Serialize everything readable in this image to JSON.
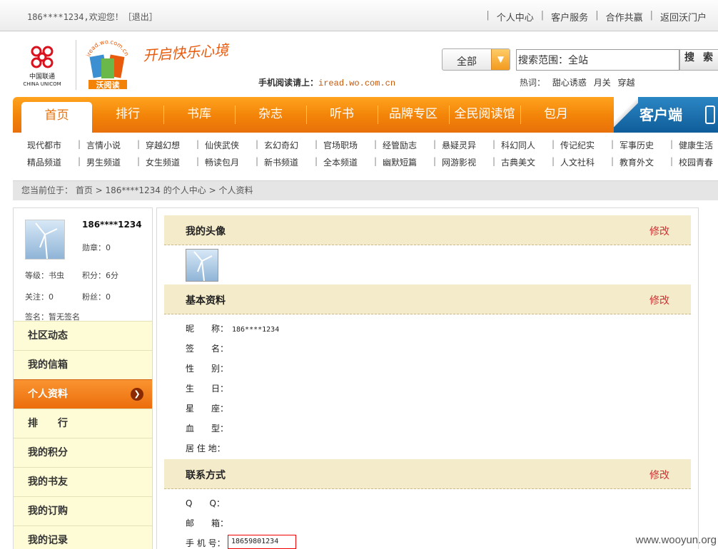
{
  "topbar": {
    "welcome": "186****1234,欢迎您！［退出］",
    "links": [
      "个人中心",
      "客户服务",
      "合作共赢",
      "返回沃门户"
    ]
  },
  "header": {
    "brand_name": "中国联通",
    "brand_name_en": "CHINA UNICOM",
    "logo_text": "沃阅读",
    "logo_arc": "iread.wo.com.cn",
    "slogan": "开启快乐心境",
    "mobile_tip_label": "手机阅读请上：",
    "mobile_tip_url": "iread.wo.com.cn"
  },
  "search": {
    "category": "全部",
    "input_value": "搜索范围：全站",
    "button": "搜索",
    "hot_label": "热词：",
    "hot_words": [
      "甜心诱惑",
      "月关",
      "穿越"
    ]
  },
  "nav": {
    "home": "首页",
    "items": [
      "排行",
      "书库",
      "杂志",
      "听书",
      "品牌专区",
      "全民阅读馆",
      "包月"
    ],
    "client": "客户端"
  },
  "subnav": {
    "row1": [
      "现代都市",
      "言情小说",
      "穿越幻想",
      "仙侠武侠",
      "玄幻奇幻",
      "官场职场",
      "经管励志",
      "悬疑灵异",
      "科幻同人",
      "传记纪实",
      "军事历史",
      "健康生活"
    ],
    "row2": [
      "精品频道",
      "男生频道",
      "女生频道",
      "畅读包月",
      "新书频道",
      "全本频道",
      "幽默短篇",
      "网游影视",
      "古典美文",
      "人文社科",
      "教育外文",
      "校园青春"
    ]
  },
  "breadcrumb": "您当前位于： 首页 > 186****1234 的个人中心 > 个人资料",
  "sidebar": {
    "username": "186****1234",
    "medal": "勋章：0",
    "level": "等级：书虫",
    "points": "积分：6分",
    "follow": "关注：0",
    "fans": "粉丝：0",
    "signature": "签名：暂无签名",
    "menu": [
      "社区动态",
      "我的信箱",
      "个人资料",
      "排　　行",
      "我的积分",
      "我的书友",
      "我的订购",
      "我的记录"
    ],
    "active_index": 2
  },
  "main": {
    "avatar_section": {
      "title": "我的头像",
      "edit": "修改"
    },
    "basic_section": {
      "title": "基本资料",
      "edit": "修改"
    },
    "basic_fields": [
      {
        "label": "昵　　称：",
        "value": "186****1234"
      },
      {
        "label": "签　　名：",
        "value": ""
      },
      {
        "label": "性　　别：",
        "value": ""
      },
      {
        "label": "生　　日：",
        "value": ""
      },
      {
        "label": "星　　座：",
        "value": ""
      },
      {
        "label": "血　　型：",
        "value": ""
      },
      {
        "label": "居 住 地：",
        "value": ""
      }
    ],
    "contact_section": {
      "title": "联系方式",
      "edit": "修改"
    },
    "contact_fields": [
      {
        "label": "Q　　Q：",
        "value": ""
      },
      {
        "label": "邮　　箱：",
        "value": ""
      },
      {
        "label": "手 机 号：",
        "value": "18659801234"
      }
    ]
  },
  "watermark": "www.wooyun.org",
  "colors": {
    "nav_orange": "#f28308",
    "client_blue": "#1a6aa8",
    "edit_red": "#cc3333",
    "section_bg": "#f4ebca"
  }
}
